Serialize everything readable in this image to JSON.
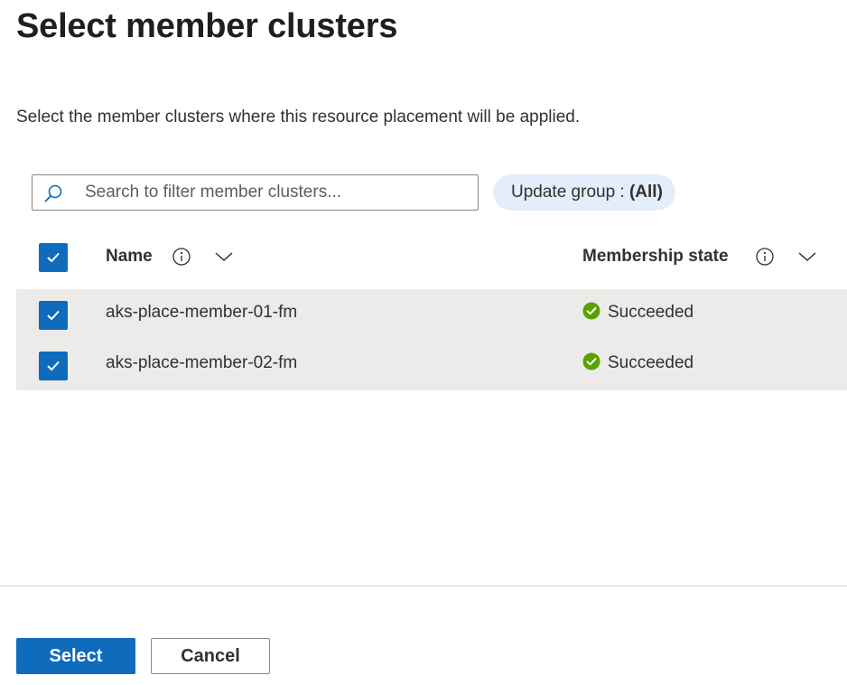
{
  "dialog": {
    "title": "Select member clusters",
    "description": "Select the member clusters where this resource placement will be applied."
  },
  "filter": {
    "search_placeholder": "Search to filter member clusters...",
    "update_group_label": "Update group : ",
    "update_group_value": "(All)"
  },
  "table": {
    "columns": [
      {
        "label": "Name"
      },
      {
        "label": "Membership state"
      }
    ],
    "select_all_checked": true,
    "rows": [
      {
        "name": "aks-place-member-01-fm",
        "state": "Succeeded",
        "checked": true
      },
      {
        "name": "aks-place-member-02-fm",
        "state": "Succeeded",
        "checked": true
      }
    ]
  },
  "footer": {
    "select_label": "Select",
    "cancel_label": "Cancel"
  },
  "colors": {
    "accent": "#0f6cbd",
    "success": "#57a300",
    "row_selected": "#edebe9",
    "pill": "#e3eefa"
  }
}
